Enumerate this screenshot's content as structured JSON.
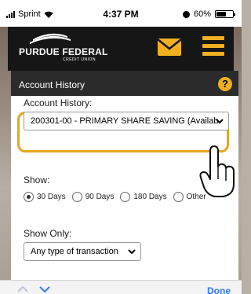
{
  "status_bar": {
    "carrier": "Sprint",
    "time": "4:37 PM",
    "battery": "60%",
    "battery_level": 0.6,
    "icons": [
      "signal-icon",
      "wifi-icon",
      "alarm-icon",
      "battery-icon"
    ]
  },
  "header": {
    "logo_text": "PURDUE FEDERAL",
    "logo_subtext": "CREDIT UNION",
    "icons": [
      "mail-icon",
      "menu-icon"
    ],
    "accent_color": "#f0b020"
  },
  "dialog": {
    "title": "Account History",
    "help_icon": "?",
    "account_label": "Account History:",
    "account_value": "200301-00 - PRIMARY SHARE SAVING (Availab",
    "show_label": "Show:",
    "show_options": [
      "30 Days",
      "90 Days",
      "180 Days",
      "Other"
    ],
    "show_selected": "30 Days",
    "showonly_label": "Show Only:",
    "showonly_value": "Any type of transaction",
    "highlight_color": "#e8a61c"
  },
  "toolbar": {
    "done_label": "Done",
    "icons": [
      "chevron-up-icon",
      "chevron-down-icon"
    ]
  }
}
